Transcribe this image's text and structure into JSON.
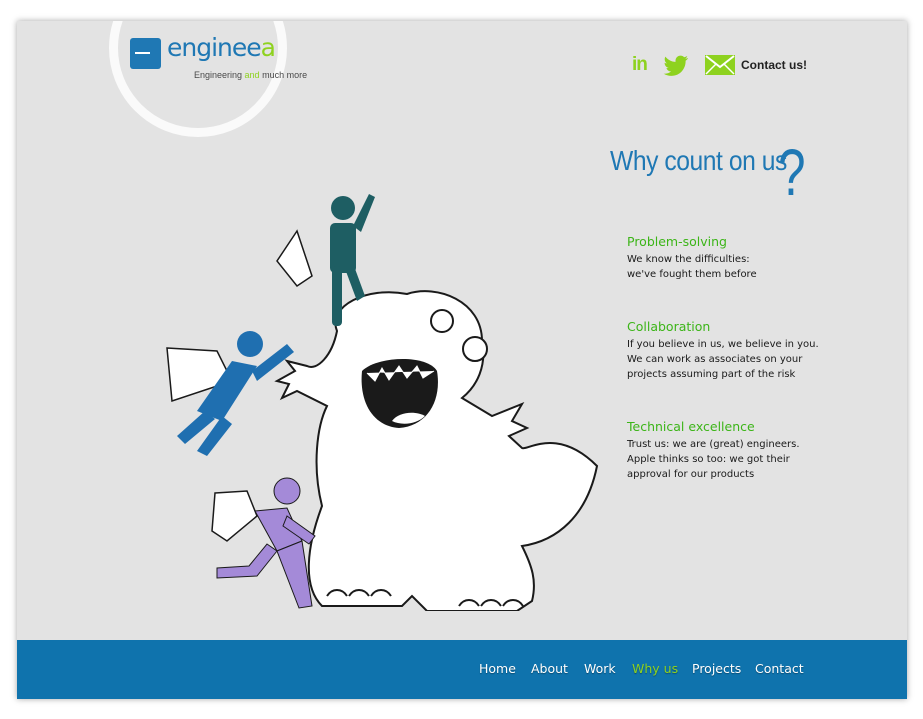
{
  "logo": {
    "word_main": "engine",
    "word_accent_e": "e",
    "word_end": "a",
    "tag_start": "Engineering ",
    "tag_accent": "and",
    "tag_end": " much more"
  },
  "header": {
    "linkedin_label": "in",
    "contact_label": "Contact us!"
  },
  "headline": {
    "text": "Why count on us",
    "mark": "?"
  },
  "features": [
    {
      "title": "Problem-solving",
      "lines": [
        "We know the difficulties:",
        "we've fought them before"
      ]
    },
    {
      "title": "Collaboration",
      "lines": [
        "If you believe in us, we believe in you.",
        "We can work as associates on your",
        "projects assuming part of the risk"
      ]
    },
    {
      "title": "Technical excellence",
      "lines": [
        "Trust us: we are (great) engineers.",
        "Apple thinks so too: we got their",
        "approval for our products"
      ]
    }
  ],
  "nav": {
    "items": [
      "Home",
      "About",
      "Work",
      "Why us",
      "Projects",
      "Contact"
    ],
    "active": "Why us"
  },
  "colors": {
    "brand_blue": "#1f78b4",
    "accent_green": "#8ed21f",
    "nav_bg": "#0f73ad",
    "feature_title_green": "#3cb518",
    "figure_teal": "#1e5e63",
    "figure_blue": "#1f6fb0",
    "figure_purple": "#a48ad8",
    "background": "#e3e3e3"
  },
  "icons": [
    "linkedin-icon",
    "twitter-icon",
    "mail-icon"
  ]
}
